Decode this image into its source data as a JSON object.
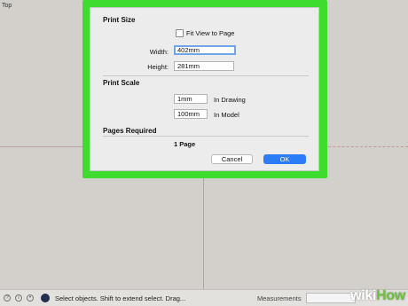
{
  "viewport": {
    "view_label": "Top"
  },
  "dialog": {
    "print_size": {
      "title": "Print Size",
      "fit_label": "Fit View to Page",
      "width_label": "Width:",
      "width_value": "402mm",
      "height_label": "Height:",
      "height_value": "281mm"
    },
    "print_scale": {
      "title": "Print Scale",
      "drawing_value": "1mm",
      "drawing_label": "In Drawing",
      "model_value": "100mm",
      "model_label": "In Model"
    },
    "pages_required": {
      "title": "Pages Required",
      "value": "1 Page"
    },
    "buttons": {
      "cancel": "Cancel",
      "ok": "OK"
    }
  },
  "statusbar": {
    "message": "Select objects. Shift to extend select. Drag...",
    "measurements_label": "Measurements",
    "icons": [
      "georeference-icon",
      "info-icon",
      "user-icon",
      "instructor-icon"
    ]
  },
  "watermark": {
    "wiki": "wiki",
    "how": "How"
  },
  "colors": {
    "highlight": "#3ddc2e",
    "ok_button": "#2b7cf6",
    "focus_ring": "#6fa6e8"
  }
}
